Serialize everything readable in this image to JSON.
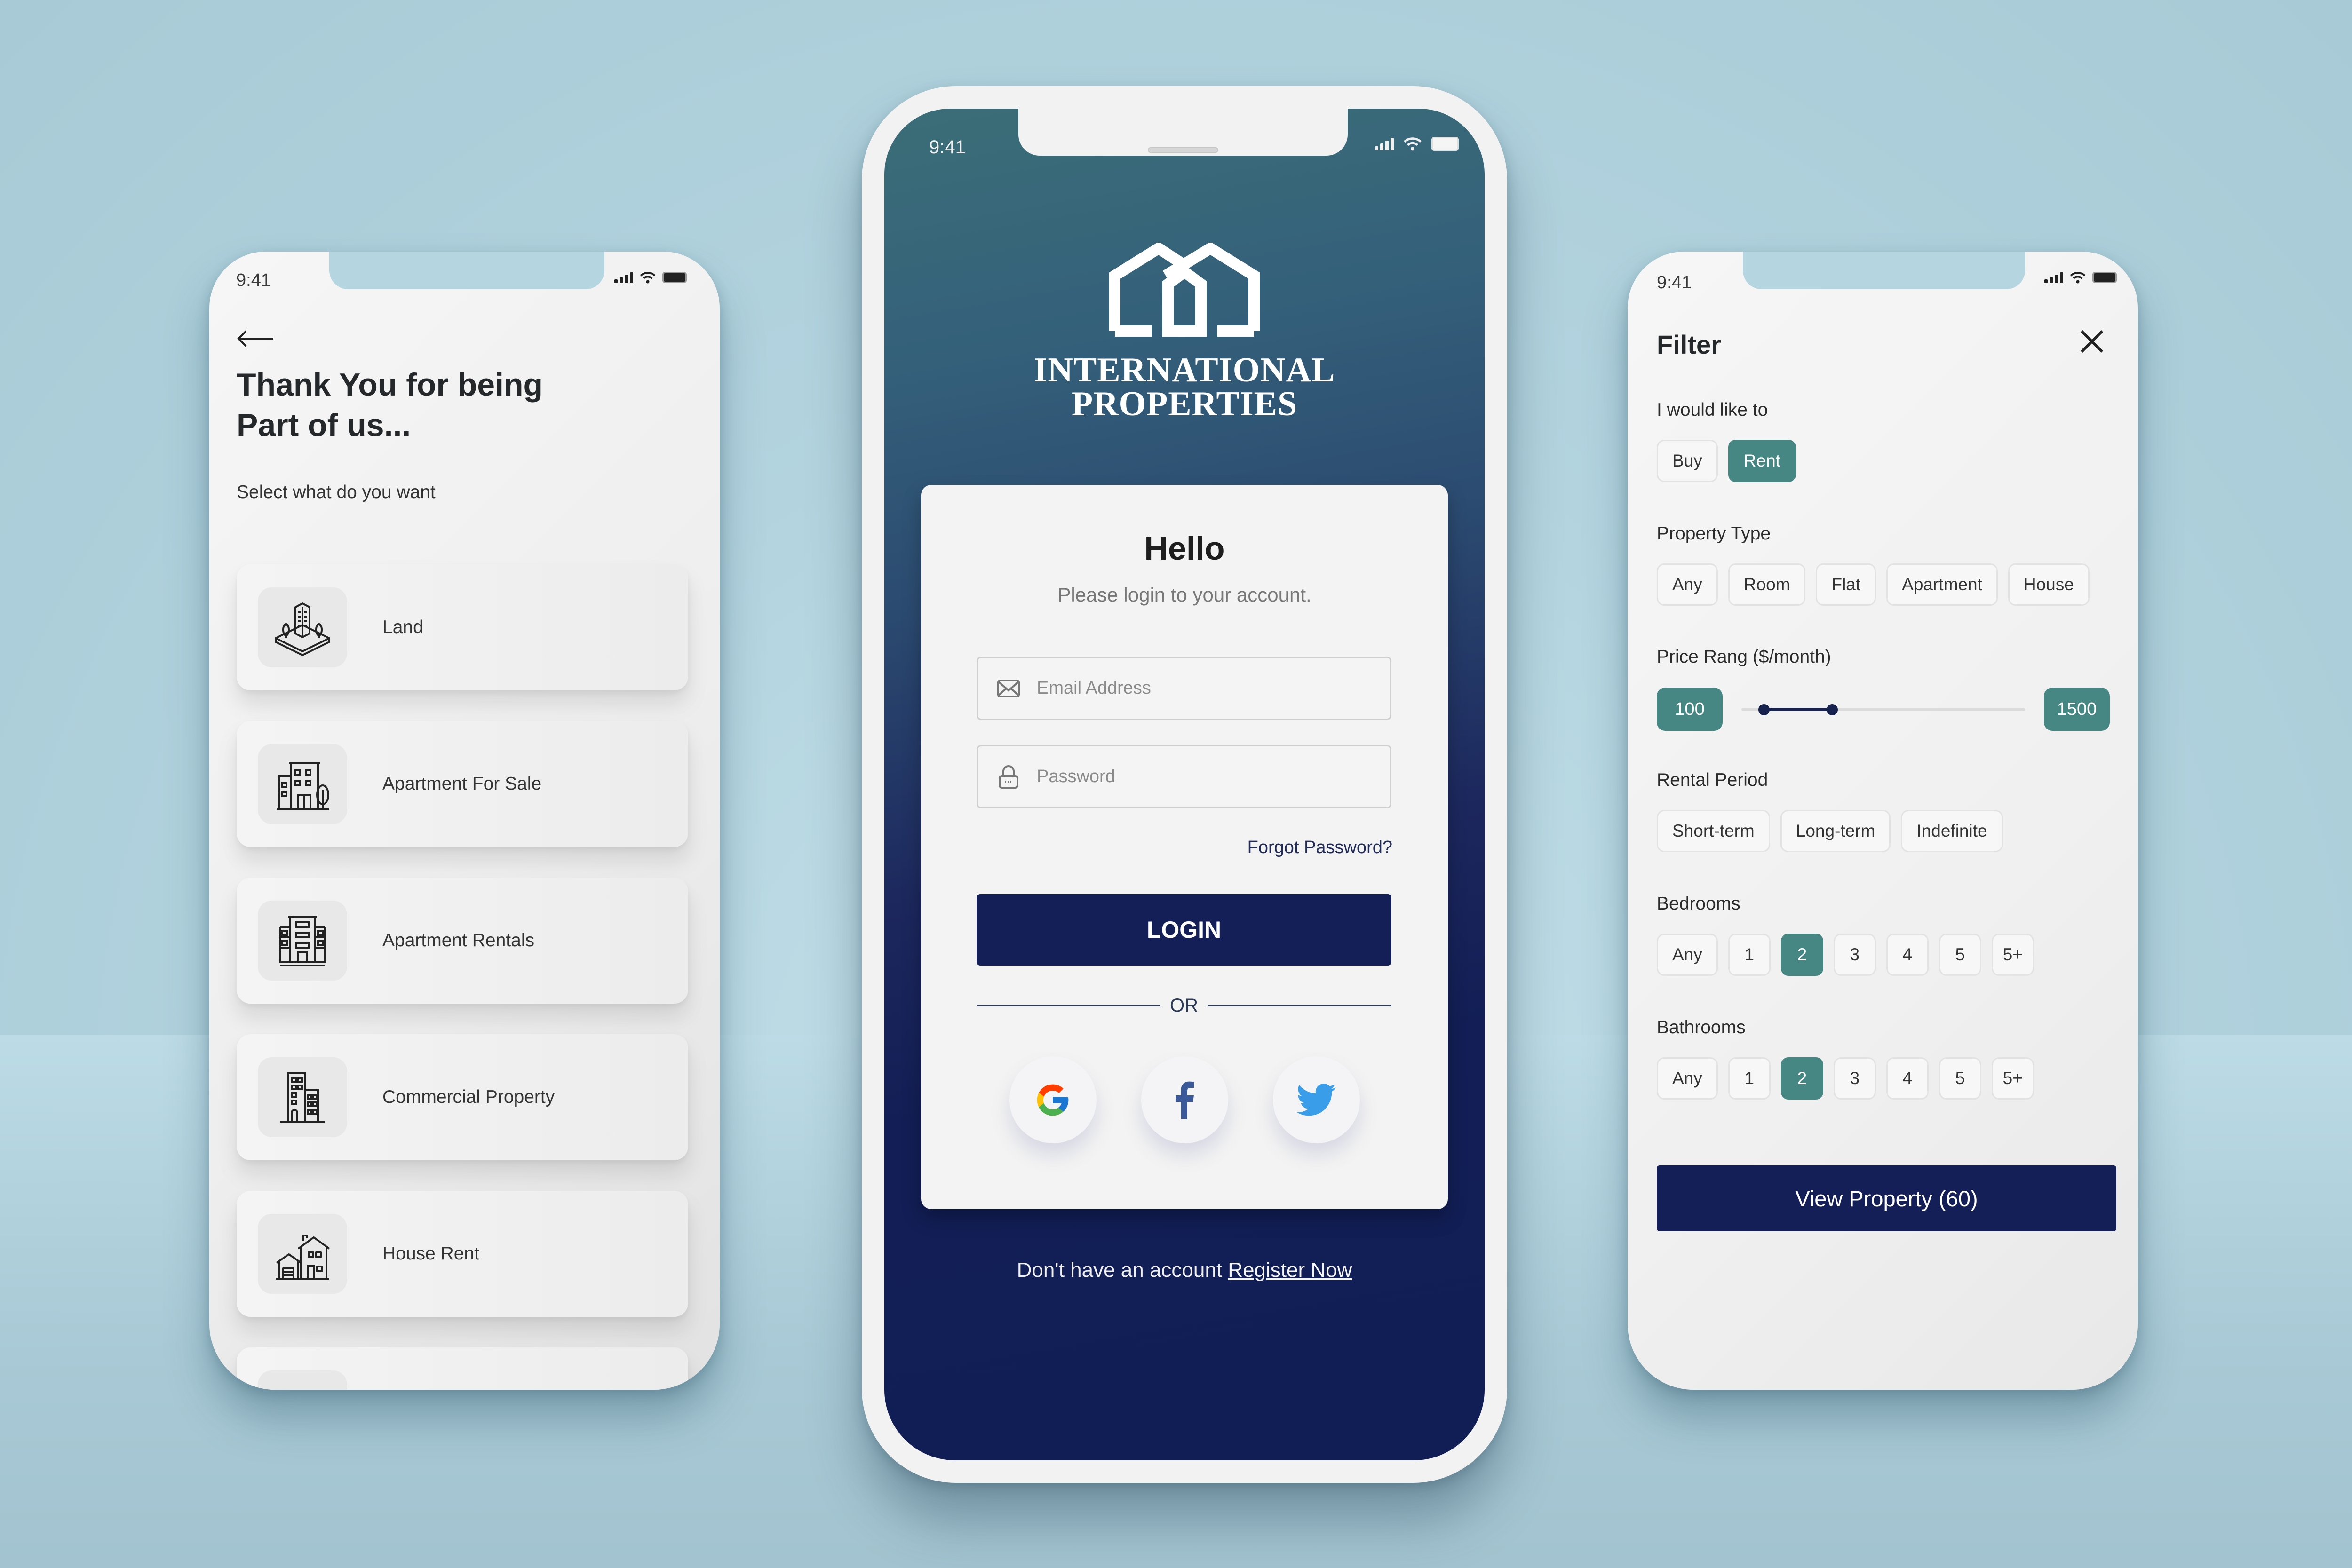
{
  "status_bar": {
    "time": "9:41"
  },
  "left_screen": {
    "back_icon": "arrow-left-icon",
    "title_line1": "Thank You for being",
    "title_line2": "Part of us...",
    "subtitle": "Select what do you want",
    "options": [
      {
        "label": "Land",
        "icon": "land-tower-icon"
      },
      {
        "label": "Apartment For Sale",
        "icon": "apartment-building-icon"
      },
      {
        "label": "Apartment Rentals",
        "icon": "apartment-balconies-icon"
      },
      {
        "label": "Commercial Property",
        "icon": "office-building-icon"
      },
      {
        "label": "House Rent",
        "icon": "house-icon"
      }
    ]
  },
  "center_screen": {
    "brand_line1": "INTERNATIONAL",
    "brand_line2": "PROPERTIES",
    "card": {
      "heading": "Hello",
      "subheading": "Please login to your account.",
      "email_placeholder": "Email Address",
      "email_value": "",
      "password_placeholder": "Password",
      "password_value": "",
      "forgot_label": "Forgot Password?",
      "login_label": "LOGIN",
      "or_label": "OR",
      "socials": [
        "google",
        "facebook",
        "twitter"
      ]
    },
    "register_prompt": "Don't have an account ",
    "register_link": "Register Now"
  },
  "right_screen": {
    "title": "Filter",
    "intent": {
      "label": "I would like to",
      "options": [
        "Buy",
        "Rent"
      ],
      "selected": "Rent"
    },
    "property_type": {
      "label": "Property Type",
      "options": [
        "Any",
        "Room",
        "Flat",
        "Apartment",
        "House"
      ],
      "selected": null
    },
    "price": {
      "label": "Price Rang ($/month)",
      "min_label": "100",
      "max_label": "1500",
      "range_min": 100,
      "range_max": 1500,
      "selected_low_fraction": 0.08,
      "selected_high_fraction": 0.32
    },
    "rental_period": {
      "label": "Rental Period",
      "options": [
        "Short-term",
        "Long-term",
        "Indefinite"
      ],
      "selected": null
    },
    "bedrooms": {
      "label": "Bedrooms",
      "options": [
        "Any",
        "1",
        "2",
        "3",
        "4",
        "5",
        "5+"
      ],
      "selected": "2"
    },
    "bathrooms": {
      "label": "Bathrooms",
      "options": [
        "Any",
        "1",
        "2",
        "3",
        "4",
        "5",
        "5+"
      ],
      "selected": "2"
    },
    "view_button": "View Property (60)"
  },
  "colors": {
    "accent_teal": "#478783",
    "primary_navy": "#141F57",
    "background": "#B3D4DF"
  }
}
